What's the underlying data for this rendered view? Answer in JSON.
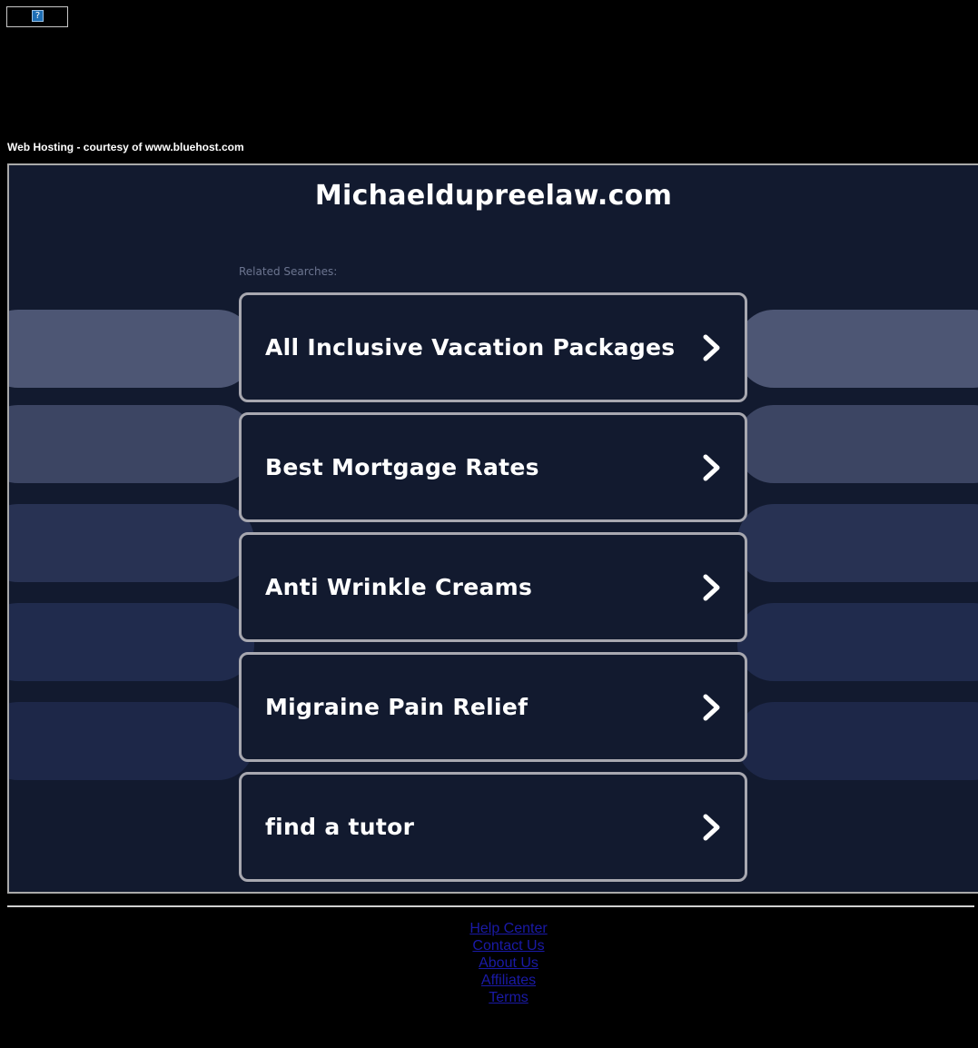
{
  "broken_image": {
    "glyph": "?"
  },
  "hosting_note": "Web Hosting - courtesy of www.bluehost.com",
  "site_title": "Michaeldupreelaw.com",
  "related_label": "Related Searches:",
  "searches": [
    {
      "label": "All Inclusive Vacation Packages",
      "icon": "chevron-right-icon"
    },
    {
      "label": "Best Mortgage Rates",
      "icon": "chevron-right-icon"
    },
    {
      "label": "Anti Wrinkle Creams",
      "icon": "chevron-right-icon"
    },
    {
      "label": "Migraine Pain Relief",
      "icon": "chevron-right-icon"
    },
    {
      "label": "find a tutor",
      "icon": "chevron-right-icon"
    }
  ],
  "footer_links": [
    "Help Center",
    "Contact Us",
    "About Us",
    "Affiliates",
    "Terms"
  ],
  "colors": {
    "page_background": "#000000",
    "panel_background": "#121a2f",
    "button_border": "#a8a8b0",
    "link": "#1a1aa6"
  }
}
